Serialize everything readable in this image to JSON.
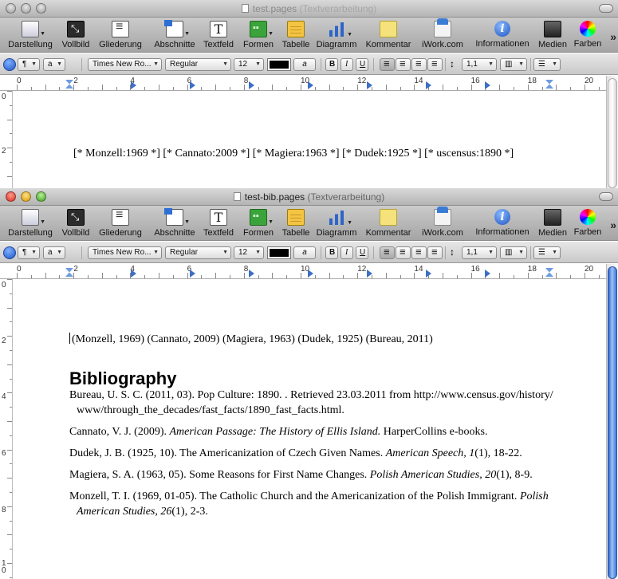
{
  "toolbar": {
    "items": [
      {
        "label": "Darstellung",
        "icon": "view-icon"
      },
      {
        "label": "Vollbild",
        "icon": "fullscreen-icon"
      },
      {
        "label": "Gliederung",
        "icon": "outline-icon"
      },
      {
        "label": "Abschnitte",
        "icon": "sections-icon"
      },
      {
        "label": "Textfeld",
        "icon": "textbox-icon"
      },
      {
        "label": "Formen",
        "icon": "shapes-icon"
      },
      {
        "label": "Tabelle",
        "icon": "table-icon"
      },
      {
        "label": "Diagramm",
        "icon": "chart-icon"
      },
      {
        "label": "Kommentar",
        "icon": "comment-icon"
      },
      {
        "label": "iWork.com",
        "icon": "iwork-icon"
      },
      {
        "label": "Informationen",
        "icon": "info-icon"
      },
      {
        "label": "Medien",
        "icon": "media-icon"
      },
      {
        "label": "Farben",
        "icon": "colors-icon"
      }
    ],
    "overflow": "»"
  },
  "formatbar": {
    "paragraph_style": "¶",
    "char_style": "a",
    "font_family": "Times New Ro...",
    "font_style": "Regular",
    "font_size": "12",
    "text_color": "#000000",
    "highlight_label": "a",
    "bold": "B",
    "italic": "I",
    "underline": "U",
    "line_spacing": "1,1"
  },
  "ruler": {
    "numbers": [
      "0",
      "2",
      "4",
      "6",
      "8",
      "10",
      "12",
      "14",
      "16",
      "18",
      "20"
    ]
  },
  "window1": {
    "title": "test.pages",
    "subtitle": "(Textverarbeitung)",
    "vruler_numbers": [
      "0",
      "2"
    ],
    "content": "[* Monzell:1969 *] [* Cannato:2009 *] [* Magiera:1963 *] [* Dudek:1925 *] [* uscensus:1890 *]"
  },
  "window2": {
    "title": "test-bib.pages",
    "subtitle": "(Textverarbeitung)",
    "vruler_numbers": [
      "0",
      "2",
      "4",
      "6",
      "8",
      "1\n0"
    ],
    "citations": "(Monzell, 1969) (Cannato, 2009) (Magiera, 1963) (Dudek, 1925) (Bureau, 2011)",
    "bibliography_heading": "Bibliography",
    "entries": [
      {
        "pre": "Bureau, U. S. C. (2011, 03). Pop Culture: 1890. . Retrieved 23.03.2011 from http://www.census.gov/history/www/through_the_decades/fast_facts/1890_fast_facts.html.",
        "italic": "",
        "post": ""
      },
      {
        "pre": "Cannato, V. J. (2009). ",
        "italic": "American Passage: The History of Ellis Island.",
        "post": " HarperCollins e-books."
      },
      {
        "pre": "Dudek, J. B. (1925, 10). The Americanization of Czech Given Names. ",
        "italic": "American Speech, 1",
        "post": "(1), 18-22."
      },
      {
        "pre": "Magiera, S. A. (1963, 05). Some Reasons for First Name Changes. ",
        "italic": "Polish American Studies, 20",
        "post": "(1), 8-9."
      },
      {
        "pre": "Monzell, T. I. (1969, 01-05). The Catholic Church and the Americanization of the Polish Immigrant. ",
        "italic": "Polish American Studies, 26",
        "post": "(1), 2-3."
      }
    ]
  }
}
